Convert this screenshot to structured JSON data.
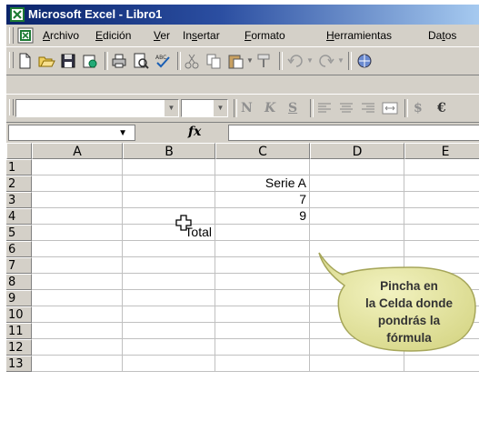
{
  "window": {
    "title": "Microsoft Excel - Libro1"
  },
  "menu": [
    {
      "label": "Archivo"
    },
    {
      "label": "Edición"
    },
    {
      "label": "Ver"
    },
    {
      "label": "Insertar"
    },
    {
      "label": "Formato"
    },
    {
      "label": "Herramientas"
    },
    {
      "label": "Datos"
    }
  ],
  "toolbar": {
    "standard_icons": [
      "new-icon",
      "open-icon",
      "save-icon",
      "permissions-icon",
      "print-icon",
      "print-preview-icon",
      "spelling-icon",
      "cut-icon",
      "copy-icon",
      "paste-icon",
      "format-painter-icon",
      "undo-icon",
      "redo-icon",
      "hyperlink-icon"
    ],
    "format_letters": {
      "bold": "N",
      "italic": "K",
      "underline": "S",
      "currency": "$",
      "euro": "€"
    }
  },
  "formula_bar": {
    "name_box": "",
    "fx_label": "fx",
    "content": ""
  },
  "grid": {
    "columns": [
      "A",
      "B",
      "C",
      "D",
      "E"
    ],
    "rows": [
      "1",
      "2",
      "3",
      "4",
      "5",
      "6",
      "7",
      "8",
      "9",
      "10",
      "11",
      "12",
      "13"
    ],
    "cells": {
      "C2": "Serie A",
      "C3": "7",
      "C4": "9",
      "B5": "Total"
    }
  },
  "callout": {
    "lines": [
      "Pincha en",
      "la Celda donde",
      "pondrás la",
      "fórmula"
    ],
    "color": "#e8e8a6"
  },
  "colors": {
    "title_bar": "#0a246a",
    "chrome": "#d4d0c8",
    "excel_green": "#1e7b34"
  }
}
